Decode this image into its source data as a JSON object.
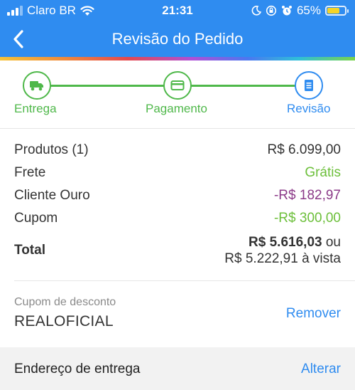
{
  "status_bar": {
    "carrier": "Claro BR",
    "time": "21:31",
    "battery": "65%",
    "battery_level": 0.65,
    "icons": [
      "signal-icon",
      "wifi-icon",
      "moon-icon",
      "lock-rotation-icon",
      "alarm-icon",
      "battery-icon"
    ]
  },
  "nav": {
    "title": "Revisão do Pedido",
    "back_icon": "chevron-left-icon"
  },
  "stepper": {
    "steps": [
      {
        "label": "Entrega",
        "icon": "truck-icon",
        "state": "complete"
      },
      {
        "label": "Pagamento",
        "icon": "credit-card-icon",
        "state": "complete"
      },
      {
        "label": "Revisão",
        "icon": "document-icon",
        "state": "current"
      }
    ],
    "colors": {
      "complete": "#4fb84a",
      "current": "#2f8cf0"
    }
  },
  "summary": {
    "rows": [
      {
        "label": "Produtos (1)",
        "value": "R$ 6.099,00"
      },
      {
        "label": "Frete",
        "value": "Grátis"
      },
      {
        "label": "Cliente Ouro",
        "value": "-R$ 182,97"
      },
      {
        "label": "Cupom",
        "value": "-R$ 300,00"
      }
    ],
    "total": {
      "label": "Total",
      "value": "R$ 5.616,03",
      "suffix": "ou",
      "alt_value": "R$ 5.222,91 à vista"
    }
  },
  "coupon": {
    "label": "Cupom de desconto",
    "code": "REALOFICIAL",
    "remove_label": "Remover"
  },
  "address": {
    "label": "Endereço de entrega",
    "change_label": "Alterar"
  },
  "colors": {
    "primary": "#2f8cf0",
    "success": "#4fb84a",
    "discount_green": "#6cbf3a",
    "gold_purple": "#8b3a88"
  }
}
